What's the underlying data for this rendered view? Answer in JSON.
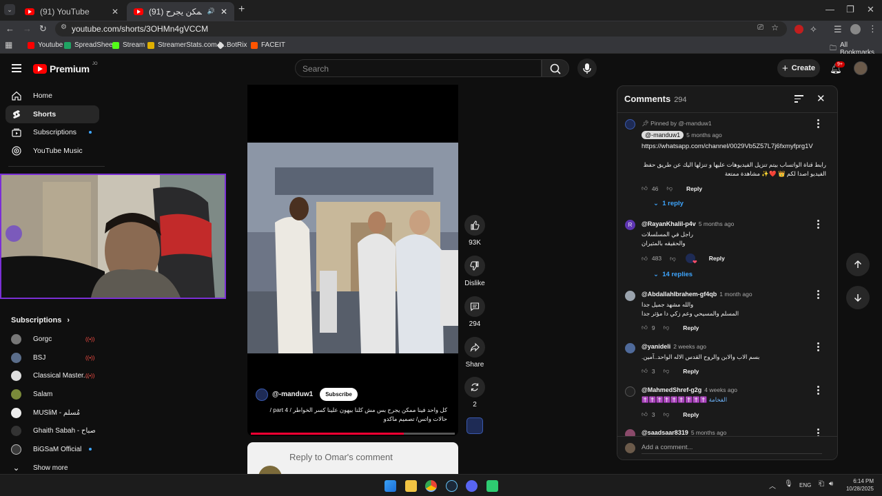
{
  "browser": {
    "tabs": [
      {
        "label": "(91) YouTube",
        "active": false
      },
      {
        "label": "(91) كل واحد فينا ممكن يجرح",
        "active": true
      }
    ],
    "url": "youtube.com/shorts/3OHMn4gVCCM",
    "bookmarks": [
      "Youtube",
      "SpreadSheet",
      "Stream",
      "StreamerStats.com |...",
      "BotRix",
      "FACEIT"
    ],
    "all_bookmarks": "All Bookmarks",
    "profile_badge": "9+"
  },
  "header": {
    "logo": "Premium",
    "logo_sup": "JO",
    "search_placeholder": "Search",
    "create_label": "Create",
    "notif_badge": "9+"
  },
  "sidebar": {
    "items": [
      {
        "label": "Home",
        "icon": "home-icon"
      },
      {
        "label": "Shorts",
        "icon": "shorts-icon"
      },
      {
        "label": "Subscriptions",
        "icon": "subscriptions-icon"
      },
      {
        "label": "YouTube Music",
        "icon": "music-icon"
      }
    ],
    "subs_header": "Subscriptions",
    "subs": [
      {
        "name": "Gorgc",
        "status": "live"
      },
      {
        "name": "BSJ",
        "status": "live"
      },
      {
        "name": "Classical Master...",
        "status": "live"
      },
      {
        "name": "Salam",
        "status": ""
      },
      {
        "name": "MUSliM - مُسلم",
        "status": ""
      },
      {
        "name": "Ghaith Sabah - صباح...",
        "status": ""
      },
      {
        "name": "BiGSaM Official",
        "status": "new"
      }
    ],
    "show_more": "Show more"
  },
  "video": {
    "channel": "@-manduw1",
    "subscribe_label": "Subscribe",
    "caption": "كل واحد فينا ممكن يجرح بس مش كلنا بيهون علينا كسر الخواطر / part 4 / حالات واتس/ تصميم ماكدو",
    "reply_banner": "Reply to Omar's comment",
    "progress": 0.75,
    "actions": [
      {
        "label": "93K",
        "icon": "like-icon"
      },
      {
        "label": "Dislike",
        "icon": "dislike-icon"
      },
      {
        "label": "294",
        "icon": "comment-icon"
      },
      {
        "label": "Share",
        "icon": "share-icon"
      },
      {
        "label": "2",
        "icon": "remix-icon"
      }
    ]
  },
  "comments": {
    "title": "Comments",
    "count": "294",
    "pinned_by": "Pinned by @-manduw1",
    "reply_label": "Reply",
    "add_placeholder": "Add a comment...",
    "items": [
      {
        "author": "@-manduw1",
        "time": "5 months ago",
        "link": "https://whatsapp.com/channel/0029Vb5Z57L7j6fxmyfprg1V",
        "text": "رابط قناة الواتساب بيتم تنزيل الفيديوهات عليها و تنزلها اليك عن طريق حفظ الفيديو اصدا لكم 👑 ❤️✨ مشاهدة ممتعة",
        "likes": "46",
        "replies": "1 reply"
      },
      {
        "author": "@RayanKhalil-p4v",
        "time": "5 months ago",
        "text": "راجل في المسلسلات\nوالحقيقه بالمثيران",
        "likes": "483",
        "replies": "14 replies"
      },
      {
        "author": "@AbdallahIbrahem-gf4qb",
        "time": "1 month ago",
        "text": "والله مشهد جميل جدا\nالمسلم والمسيحي وعم زكي دا مؤثر جدا",
        "likes": "9"
      },
      {
        "author": "@yanideli",
        "time": "2 weeks ago",
        "text": "بسم الاب والابن والروح القدس الاله الواحد..آمين.",
        "likes": "3"
      },
      {
        "author": "@MahmedShref-g2g",
        "time": "4 weeks ago",
        "text": "الفخامة ✝️✝️✝️✝️✝️✝️✝️✝️✝️",
        "likes": "3"
      },
      {
        "author": "@saadsaar8319",
        "time": "5 months ago",
        "text": "",
        "likes": ""
      }
    ]
  },
  "taskbar": {
    "lang": "ENG",
    "time": "6:14 PM",
    "date": "10/28/2025"
  },
  "colors": {
    "accent": "#ff0000",
    "link": "#3ea6ff",
    "webcam_frame": "#7b2fd6"
  }
}
